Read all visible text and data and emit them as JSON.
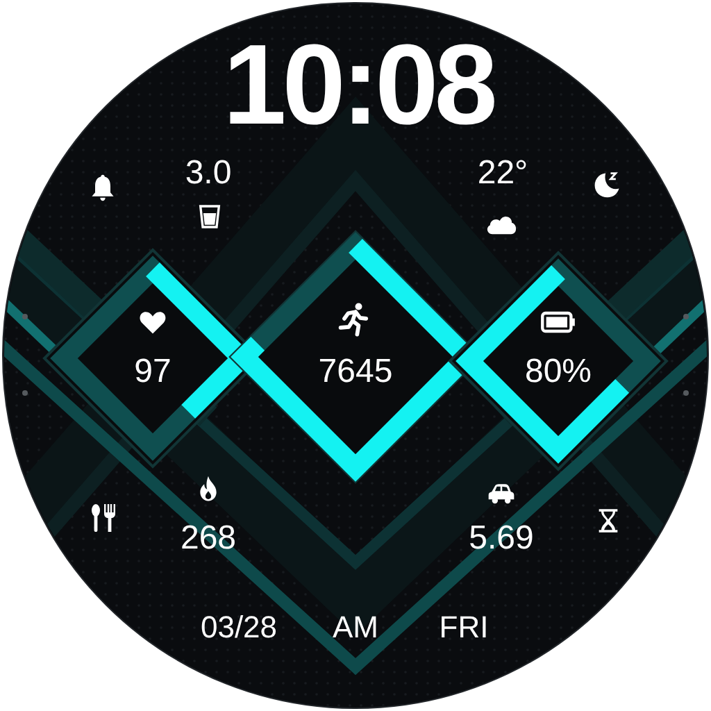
{
  "time": "10:08",
  "top_stats": [
    {
      "value": "3.0"
    },
    {
      "value": "22°"
    }
  ],
  "gauges": [
    {
      "value": "97"
    },
    {
      "value": "7645"
    },
    {
      "value": "80%"
    }
  ],
  "bottom_stats": [
    {
      "value": "268"
    },
    {
      "value": "5.69"
    }
  ],
  "date": "03/28",
  "ampm": "AM",
  "weekday": "FRI"
}
